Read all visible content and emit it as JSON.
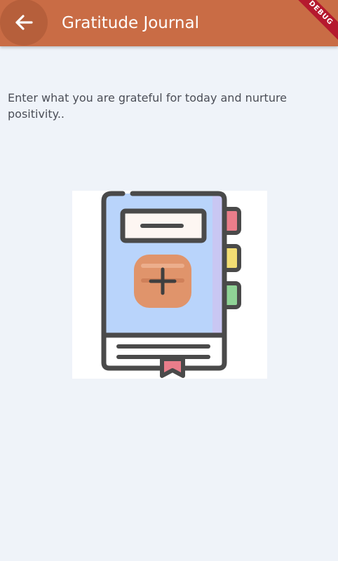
{
  "app_bar": {
    "title": "Gratitude Journal",
    "back_icon": "arrow-left-icon",
    "debug_label": "DEBUG",
    "color": "#c96c45"
  },
  "main": {
    "intro": "Enter what you are grateful for today and nurture positivity..",
    "illustration": {
      "icon": "journal-book-add-icon",
      "book_color": "#b9d4fb",
      "plus_badge_color": "#e0946b"
    }
  }
}
